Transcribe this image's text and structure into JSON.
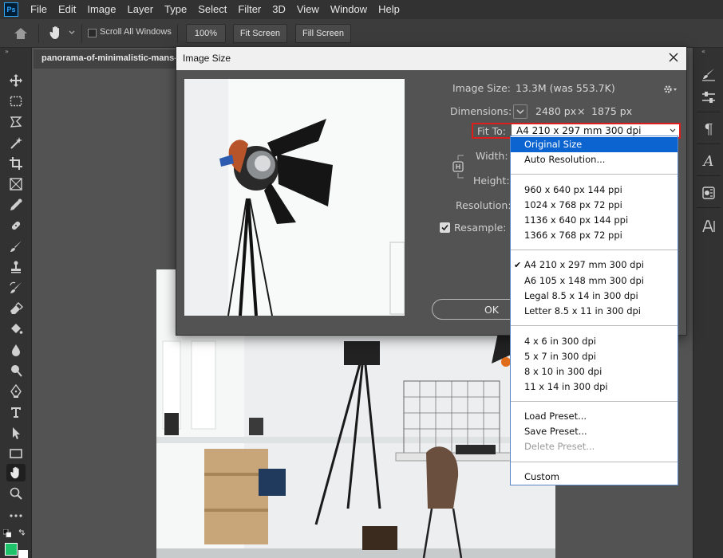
{
  "app": {
    "logo": "Ps"
  },
  "menu": [
    "File",
    "Edit",
    "Image",
    "Layer",
    "Type",
    "Select",
    "Filter",
    "3D",
    "View",
    "Window",
    "Help"
  ],
  "options_bar": {
    "scroll_all_windows": "Scroll All Windows",
    "zoom_100": "100%",
    "fit_screen": "Fit Screen",
    "fill_screen": "Fill Screen"
  },
  "document": {
    "tab_title": "panorama-of-minimalistic-mans-"
  },
  "tools": [
    {
      "icon": "move-icon"
    },
    {
      "icon": "marquee-icon"
    },
    {
      "icon": "lasso-icon"
    },
    {
      "icon": "magic-wand-icon"
    },
    {
      "icon": "crop-icon"
    },
    {
      "icon": "frame-icon"
    },
    {
      "icon": "eyedropper-icon"
    },
    {
      "icon": "healing-brush-icon"
    },
    {
      "icon": "brush-icon"
    },
    {
      "icon": "clone-stamp-icon"
    },
    {
      "icon": "history-brush-icon"
    },
    {
      "icon": "eraser-icon"
    },
    {
      "icon": "paint-bucket-icon"
    },
    {
      "icon": "blur-icon"
    },
    {
      "icon": "dodge-icon"
    },
    {
      "icon": "pen-icon"
    },
    {
      "icon": "type-icon"
    },
    {
      "icon": "path-selection-icon"
    },
    {
      "icon": "rectangle-icon"
    },
    {
      "icon": "hand-icon"
    },
    {
      "icon": "zoom-icon"
    },
    {
      "icon": "more-tools-icon"
    }
  ],
  "colors": {
    "foreground": "#1ec36a",
    "background": "#ffffff",
    "highlight": "#e01d1d",
    "selection": "#0b64d0"
  },
  "dialog": {
    "title": "Image Size",
    "image_size_label": "Image Size:",
    "image_size_value": "13.3M (was 553.7K)",
    "dimensions_label": "Dimensions:",
    "dim_width": "2480 px",
    "dim_x": "×",
    "dim_height": "1875 px",
    "fit_to_label": "Fit To:",
    "fit_to_value": "A4 210 x 297 mm 300 dpi",
    "width_label": "Width:",
    "height_label": "Height:",
    "resolution_label": "Resolution:",
    "resample_label": "Resample:",
    "ok_label": "OK"
  },
  "dropdown": {
    "groups": [
      [
        "Original Size",
        "Auto Resolution..."
      ],
      [
        "960 x 640 px 144 ppi",
        "1024 x 768 px 72 ppi",
        "1136 x 640 px 144 ppi",
        "1366 x 768 px 72 ppi"
      ],
      [
        "A4 210 x 297 mm 300 dpi",
        "A6 105 x 148 mm 300 dpi",
        "Legal 8.5 x 14 in 300 dpi",
        "Letter 8.5 x 11 in 300 dpi"
      ],
      [
        "4 x 6 in 300 dpi",
        "5 x 7 in 300 dpi",
        "8 x 10 in 300 dpi",
        "11 x 14 in 300 dpi"
      ],
      [
        "Load Preset...",
        "Save Preset...",
        "Delete Preset..."
      ],
      [
        "Custom"
      ]
    ],
    "highlighted": "Original Size",
    "checked": "A4 210 x 297 mm 300 dpi",
    "disabled": [
      "Delete Preset..."
    ]
  }
}
